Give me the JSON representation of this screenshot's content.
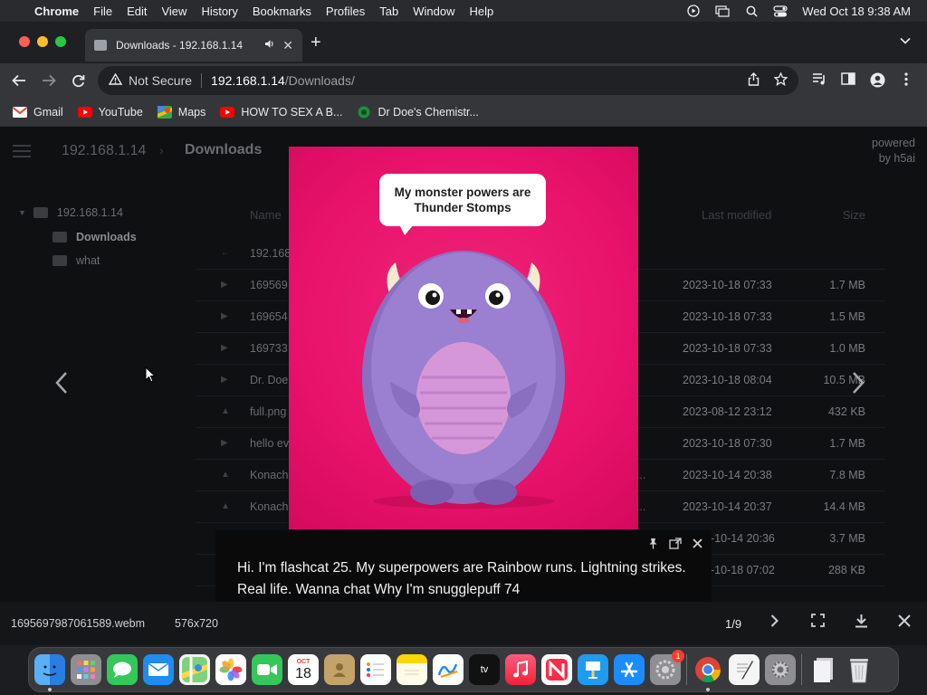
{
  "menubar": {
    "app": "Chrome",
    "items": [
      "File",
      "Edit",
      "View",
      "History",
      "Bookmarks",
      "Profiles",
      "Tab",
      "Window",
      "Help"
    ],
    "datetime": "Wed Oct 18  9:38 AM"
  },
  "tab": {
    "title": "Downloads - 192.168.1.14",
    "close": "✕"
  },
  "omnibox": {
    "security": "Not Secure",
    "url_host": "192.168.1.14",
    "url_path": "/Downloads/"
  },
  "bookmarks": [
    {
      "label": "Gmail",
      "icon": "gmail-icon",
      "color": "#ea4335"
    },
    {
      "label": "YouTube",
      "icon": "youtube-icon",
      "color": "#ff0000"
    },
    {
      "label": "Maps",
      "icon": "maps-icon",
      "color": "#34a853"
    },
    {
      "label": "HOW TO SEX A B...",
      "icon": "youtube-icon",
      "color": "#ff0000"
    },
    {
      "label": "Dr Doe's Chemistr...",
      "icon": "site-icon",
      "color": "#1e8e3e"
    }
  ],
  "page": {
    "breadcrumb_host": "192.168.1.14",
    "breadcrumb_current": "Downloads",
    "powered_line1": "powered",
    "powered_line2": "by h5ai",
    "tree": {
      "root": "192.168.1.14",
      "children": [
        "Downloads",
        "what"
      ]
    },
    "columns": {
      "name": "Name",
      "modified": "Last modified",
      "size": "Size"
    },
    "parent_row": "192.168",
    "rows": [
      {
        "name": "169569",
        "extra": "",
        "date": "2023-10-18 07:33",
        "size": "1.7 MB"
      },
      {
        "name": "169654",
        "extra": "",
        "date": "2023-10-18 07:33",
        "size": "1.5 MB"
      },
      {
        "name": "169733",
        "extra": "",
        "date": "2023-10-18 07:33",
        "size": "1.0 MB"
      },
      {
        "name": "Dr. Doe",
        "extra": "",
        "date": "2023-10-18 08:04",
        "size": "10.5 MB"
      },
      {
        "name": "full.png",
        "extra": "",
        "date": "2023-08-12 23:12",
        "size": "432 KB"
      },
      {
        "name": "hello ev",
        "extra": "",
        "date": "2023-10-18 07:30",
        "size": "1.7 MB"
      },
      {
        "name": "Konach",
        "extra": "_...",
        "date": "2023-10-14 20:38",
        "size": "7.8 MB"
      },
      {
        "name": "Konach",
        "extra": "p...",
        "date": "2023-10-14 20:37",
        "size": "14.4 MB"
      },
      {
        "name": "",
        "extra": "",
        "date": "-10-14 20:36",
        "size": "3.7 MB"
      },
      {
        "name": "",
        "extra": "",
        "date": "-10-18 07:02",
        "size": "288 KB"
      }
    ]
  },
  "preview": {
    "bubble_text": "My monster powers are Thunder Stomps"
  },
  "caption": {
    "text": "Hi. I'm flashcat 25. My superpowers are Rainbow runs. Lightning strikes. Real life. Wanna chat Why I'm snugglepuff 74"
  },
  "lightbox": {
    "filename": "1695697987061589.webm",
    "dims": "576x720",
    "counter": "1/9"
  },
  "dock": {
    "calendar_month": "OCT",
    "calendar_day": "18",
    "settings_badge": "1",
    "apps": [
      "finder-icon",
      "launchpad-icon",
      "messages-icon",
      "mail-icon",
      "maps-icon",
      "photos-icon",
      "facetime-icon",
      "calendar-icon",
      "contacts-icon",
      "reminders-icon",
      "notes-icon",
      "freeform-icon",
      "appletv-icon",
      "music-icon",
      "news-icon",
      "keynote-icon",
      "appstore-icon",
      "settings-icon",
      "chrome-icon",
      "textedit-icon",
      "preferences-icon",
      "documents-icon",
      "trash-icon"
    ]
  }
}
